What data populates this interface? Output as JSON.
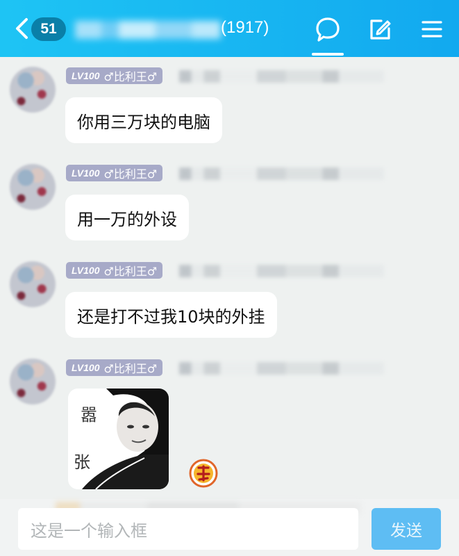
{
  "header": {
    "unread_count": "51",
    "member_count": "(1917)",
    "active_tab": "chat"
  },
  "messages": [
    {
      "level": "LV100",
      "sender": "♂比利王♂",
      "text": "你用三万块的电脑"
    },
    {
      "level": "LV100",
      "sender": "♂比利王♂",
      "text": "用一万的外设"
    },
    {
      "level": "LV100",
      "sender": "♂比利王♂",
      "text": "还是打不过我10块的外挂"
    },
    {
      "level": "LV100",
      "sender": "♂比利王♂",
      "sticker": {
        "char1": "嚣",
        "char2": "张"
      }
    }
  ],
  "input": {
    "placeholder": "这是一个输入框",
    "send_label": "发送"
  },
  "colors": {
    "header": "#12a9ef",
    "badge": "#0a7fa8",
    "level_badge": "#a7aac8",
    "send": "#5ebdf3",
    "background": "#eef1f0"
  },
  "icons": [
    "back-chevron-icon",
    "chat-bubble-icon",
    "edit-icon",
    "menu-icon",
    "reaction-icon"
  ]
}
